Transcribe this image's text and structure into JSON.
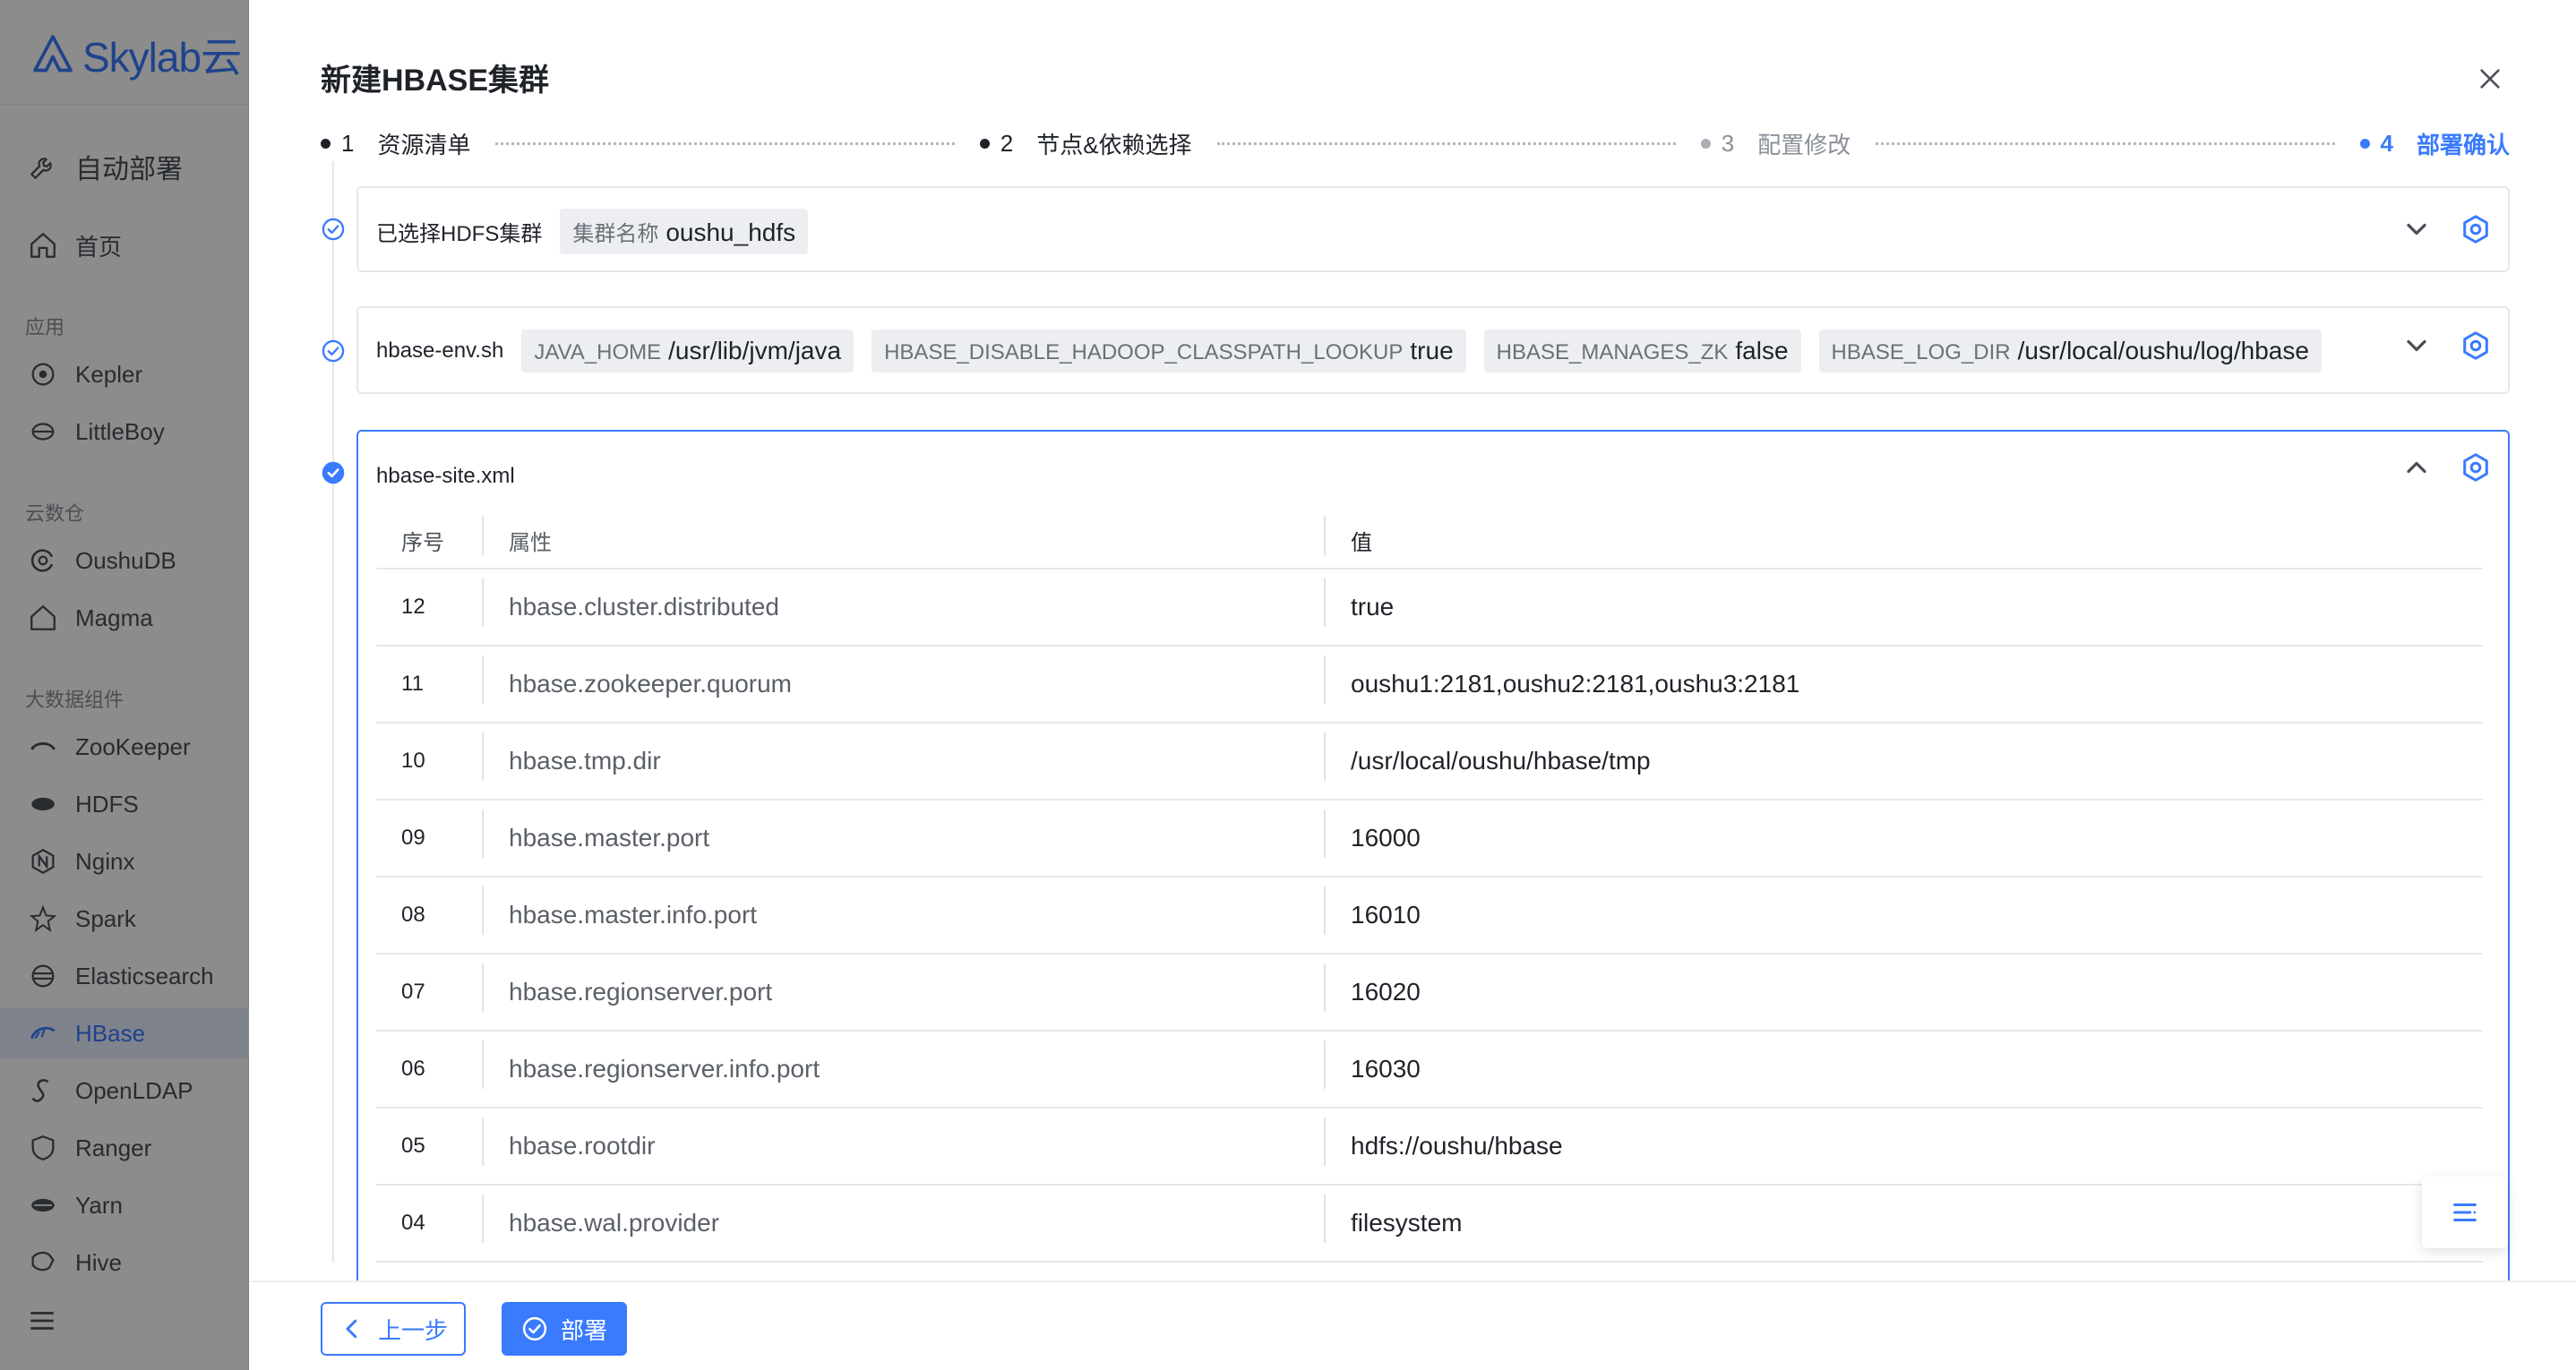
{
  "sidebar": {
    "logo_text": "Skylab云",
    "main_item": "自动部署",
    "home": "首页",
    "groups": {
      "apps": "应用",
      "warehouse": "云数仓",
      "bigdata": "大数据组件"
    },
    "items": [
      {
        "label": "Kepler",
        "icon": "kepler-icon"
      },
      {
        "label": "LittleBoy",
        "icon": "littleboy-icon"
      },
      {
        "label": "OushuDB",
        "icon": "oushudb-icon"
      },
      {
        "label": "Magma",
        "icon": "magma-icon"
      },
      {
        "label": "ZooKeeper",
        "icon": "zookeeper-icon"
      },
      {
        "label": "HDFS",
        "icon": "hdfs-icon"
      },
      {
        "label": "Nginx",
        "icon": "nginx-icon"
      },
      {
        "label": "Spark",
        "icon": "spark-icon"
      },
      {
        "label": "Elasticsearch",
        "icon": "elasticsearch-icon"
      },
      {
        "label": "HBase",
        "icon": "hbase-icon",
        "active": true
      },
      {
        "label": "OpenLDAP",
        "icon": "openldap-icon"
      },
      {
        "label": "Ranger",
        "icon": "ranger-icon"
      },
      {
        "label": "Yarn",
        "icon": "yarn-icon"
      },
      {
        "label": "Hive",
        "icon": "hive-icon"
      }
    ]
  },
  "drawer": {
    "title": "新建HBASE集群",
    "steps": [
      {
        "num": "1",
        "label": "资源清单",
        "state": "done"
      },
      {
        "num": "2",
        "label": "节点&依赖选择",
        "state": "done"
      },
      {
        "num": "3",
        "label": "配置修改",
        "state": "pending"
      },
      {
        "num": "4",
        "label": "部署确认",
        "state": "active"
      }
    ],
    "hdfs_card": {
      "label": "已选择HDFS集群",
      "tag_key": "集群名称",
      "tag_value": "oushu_hdfs"
    },
    "env_card": {
      "label": "hbase-env.sh",
      "tags": [
        {
          "key": "JAVA_HOME",
          "value": "/usr/lib/jvm/java"
        },
        {
          "key": "HBASE_DISABLE_HADOOP_CLASSPATH_LOOKUP",
          "value": "true"
        },
        {
          "key": "HBASE_MANAGES_ZK",
          "value": "false"
        },
        {
          "key": "HBASE_LOG_DIR",
          "value": "/usr/local/oushu/log/hbase"
        }
      ]
    },
    "site_card": {
      "label": "hbase-site.xml",
      "columns": {
        "no": "序号",
        "prop": "属性",
        "value": "值"
      },
      "rows": [
        {
          "no": "12",
          "prop": "hbase.cluster.distributed",
          "value": "true"
        },
        {
          "no": "11",
          "prop": "hbase.zookeeper.quorum",
          "value": "oushu1:2181,oushu2:2181,oushu3:2181"
        },
        {
          "no": "10",
          "prop": "hbase.tmp.dir",
          "value": "/usr/local/oushu/hbase/tmp"
        },
        {
          "no": "09",
          "prop": "hbase.master.port",
          "value": "16000"
        },
        {
          "no": "08",
          "prop": "hbase.master.info.port",
          "value": "16010"
        },
        {
          "no": "07",
          "prop": "hbase.regionserver.port",
          "value": "16020"
        },
        {
          "no": "06",
          "prop": "hbase.regionserver.info.port",
          "value": "16030"
        },
        {
          "no": "05",
          "prop": "hbase.rootdir",
          "value": "hdfs://oushu/hbase"
        },
        {
          "no": "04",
          "prop": "hbase.wal.provider",
          "value": "filesystem"
        }
      ]
    },
    "footer": {
      "prev_label": "上一步",
      "deploy_label": "部署"
    }
  },
  "colors": {
    "accent": "#3a7bfd",
    "border": "#e6e8eb",
    "tag_bg": "#eceef1",
    "muted_text": "#8a8f98"
  }
}
